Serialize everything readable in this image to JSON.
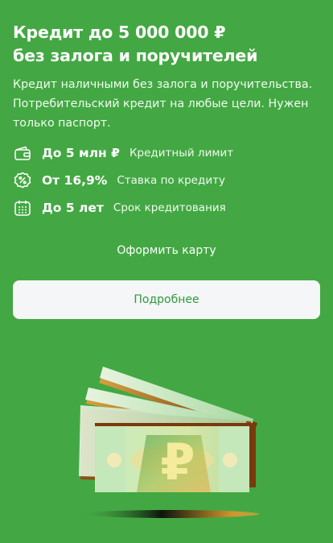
{
  "header": {
    "title_line1": "Кредит до 5 000 000 ₽",
    "title_line2": "без залога и поручителей",
    "description": "Кредит наличными без залога и поручительства. Потребительский кредит на любые цели. Нужен только паспорт."
  },
  "features": [
    {
      "icon": "wallet-icon",
      "value": "До 5 млн ₽",
      "label": "Кредитный лимит"
    },
    {
      "icon": "percent-icon",
      "value": "От 16,9%",
      "label": "Ставка по кредиту"
    },
    {
      "icon": "calendar-icon",
      "value": "До 5 лет",
      "label": "Срок кредитования"
    }
  ],
  "actions": {
    "apply_label": "Оформить карту",
    "more_label": "Подробнее"
  },
  "illustration": {
    "symbol": "₽",
    "name": "banknotes-illustration"
  },
  "colors": {
    "background": "#43a843",
    "button_bg": "#f4f6f7",
    "button_text": "#2f9a3c"
  }
}
